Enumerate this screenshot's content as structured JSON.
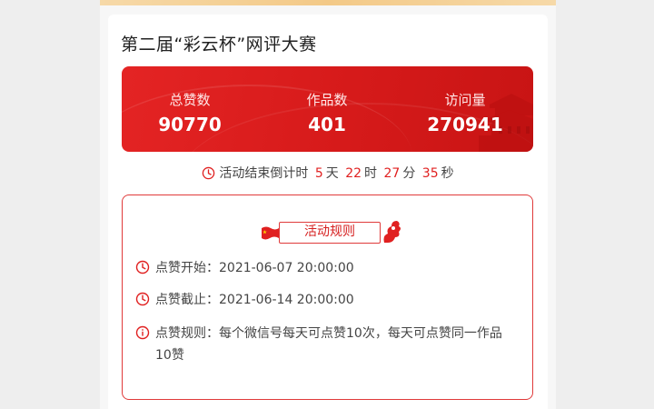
{
  "contest": {
    "title": "第二届“彩云杯”网评大赛"
  },
  "stats": [
    {
      "label": "总赞数",
      "value": "90770"
    },
    {
      "label": "作品数",
      "value": "401"
    },
    {
      "label": "访问量",
      "value": "270941"
    }
  ],
  "countdown": {
    "prefix": "活动结束倒计时",
    "days": "5",
    "days_unit": "天",
    "hours": "22",
    "hours_unit": "时",
    "minutes": "27",
    "minutes_unit": "分",
    "seconds": "35",
    "seconds_unit": "秒"
  },
  "rules": {
    "title": "活动规则",
    "items": [
      {
        "icon": "clock-icon",
        "text": "点赞开始：2021-06-07 20:00:00"
      },
      {
        "icon": "clock-icon",
        "text": "点赞截止：2021-06-14 20:00:00"
      },
      {
        "icon": "info-icon",
        "text": "点赞规则：每个微信号每天可点赞10次，每天可点赞同一作品10赞"
      }
    ]
  },
  "colors": {
    "accent": "#d61a1a",
    "banner_strip": "#f3c987"
  }
}
